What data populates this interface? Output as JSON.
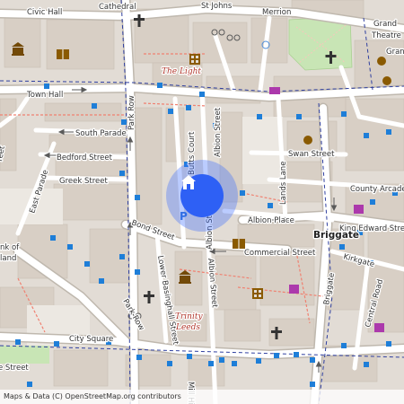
{
  "map": {
    "attribution": "Maps & Data (C) OpenStreetMap.org contributors",
    "marker": {
      "icon": "home-icon",
      "color": "#2e60f5"
    },
    "colors": {
      "background": "#e2dcd5",
      "street": "#ffffff",
      "casing": "#bfb8ae",
      "building": "#d8cfc5",
      "park": "#c8e5b5",
      "busstop": "#1e7ed8",
      "footway": "#f08070",
      "label_red": "#b0362b"
    },
    "streets": {
      "civic_hall": "Civic Hall",
      "cathedral": "Cathedral",
      "st_johns": "St Johns",
      "merrion": "Merrion",
      "grand_theatre_1": "Grand",
      "grand_theatre_2": "Theatre",
      "grand_theatre_3": "Gran",
      "town_hall": "Town Hall",
      "park_row": "Park Row",
      "south_parade": "South Parade",
      "bedford_street": "Bedford Street",
      "greek_street": "Greek Street",
      "east_parade": "East Parade",
      "butts_court": "Butts Court",
      "albion_street": "Albion Street",
      "albion_st": "Albion St",
      "swan_street": "Swan Street",
      "lands_lane": "Lands Lane",
      "county_arcade": "County Arcade",
      "albion_place": "Albion Place",
      "king_edward": "King Edward Stre",
      "bond_street": "Bond Street",
      "commercial_street": "Commercial Street",
      "briggate": "Briggate",
      "briggate_road": "Briggate",
      "kirkgate": "Kirkgate",
      "central_road": "Central Road",
      "lower_basinghall": "Lower Basinghall Street",
      "city_square": "City Square",
      "street_left": "reet",
      "street_left2": "treet",
      "mill_hill": "Mill Hill",
      "bank_of": "nk of",
      "bank_land": "land",
      "tie": "Tie",
      "street_bottom_left": "e Street"
    },
    "districts": {
      "briggate": "Briggate"
    },
    "pois": {
      "the_light": "The Light",
      "trinity_1": "Trinity",
      "trinity_2": "Leeds"
    },
    "parking": "P"
  }
}
